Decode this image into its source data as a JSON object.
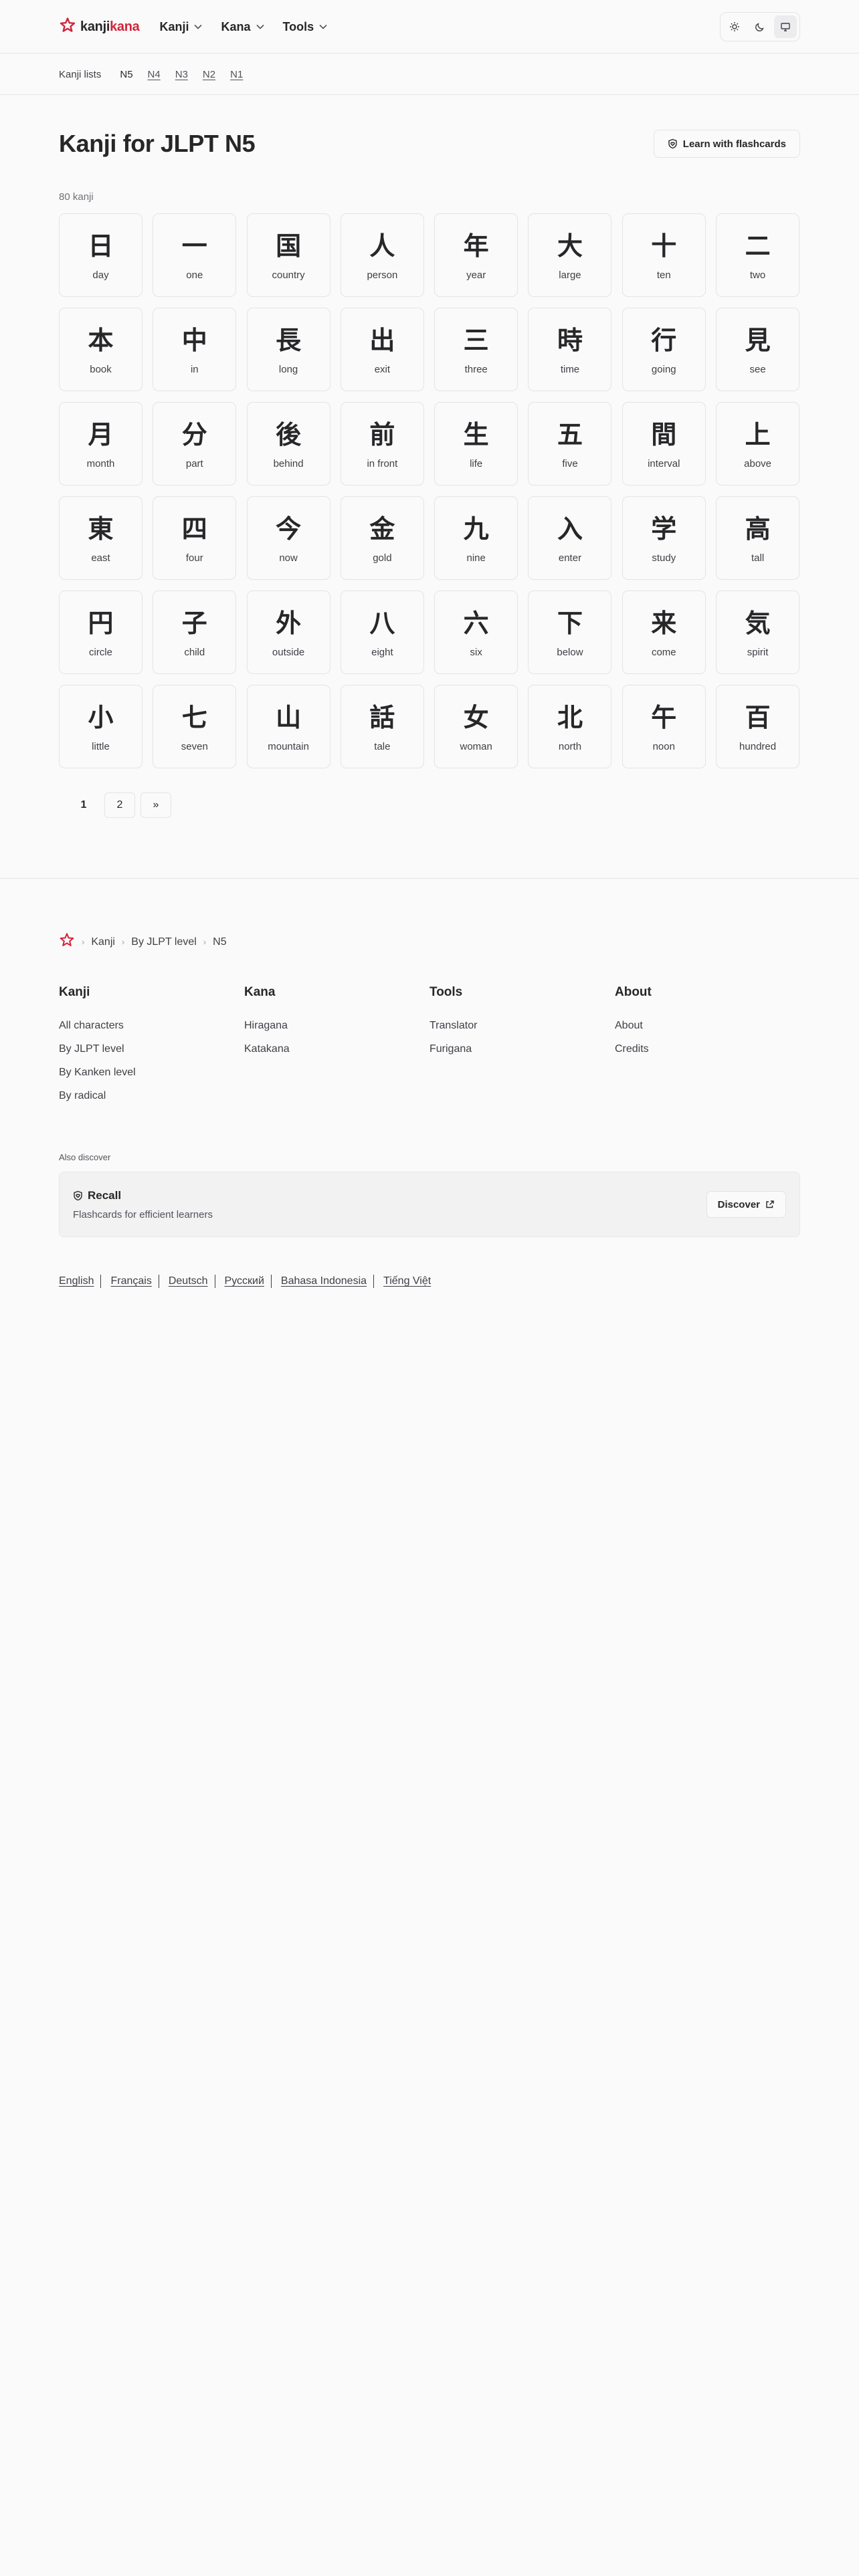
{
  "header": {
    "logo_part1": "kanji",
    "logo_part2": "kana",
    "nav": [
      {
        "label": "Kanji"
      },
      {
        "label": "Kana"
      },
      {
        "label": "Tools"
      }
    ],
    "theme_options": [
      "sun-icon",
      "moon-icon",
      "monitor-icon"
    ],
    "theme_active": "monitor-icon"
  },
  "subnav": {
    "label": "Kanji lists",
    "levels": [
      "N5",
      "N4",
      "N3",
      "N2",
      "N1"
    ],
    "current": "N5"
  },
  "main": {
    "title": "Kanji for JLPT N5",
    "flashcards_label": "Learn with flashcards",
    "count": "80 kanji"
  },
  "kanji": [
    {
      "char": "日",
      "meaning": "day"
    },
    {
      "char": "一",
      "meaning": "one"
    },
    {
      "char": "国",
      "meaning": "country"
    },
    {
      "char": "人",
      "meaning": "person"
    },
    {
      "char": "年",
      "meaning": "year"
    },
    {
      "char": "大",
      "meaning": "large"
    },
    {
      "char": "十",
      "meaning": "ten"
    },
    {
      "char": "二",
      "meaning": "two"
    },
    {
      "char": "本",
      "meaning": "book"
    },
    {
      "char": "中",
      "meaning": "in"
    },
    {
      "char": "長",
      "meaning": "long"
    },
    {
      "char": "出",
      "meaning": "exit"
    },
    {
      "char": "三",
      "meaning": "three"
    },
    {
      "char": "時",
      "meaning": "time"
    },
    {
      "char": "行",
      "meaning": "going"
    },
    {
      "char": "見",
      "meaning": "see"
    },
    {
      "char": "月",
      "meaning": "month"
    },
    {
      "char": "分",
      "meaning": "part"
    },
    {
      "char": "後",
      "meaning": "behind"
    },
    {
      "char": "前",
      "meaning": "in front"
    },
    {
      "char": "生",
      "meaning": "life"
    },
    {
      "char": "五",
      "meaning": "five"
    },
    {
      "char": "間",
      "meaning": "interval"
    },
    {
      "char": "上",
      "meaning": "above"
    },
    {
      "char": "東",
      "meaning": "east"
    },
    {
      "char": "四",
      "meaning": "four"
    },
    {
      "char": "今",
      "meaning": "now"
    },
    {
      "char": "金",
      "meaning": "gold"
    },
    {
      "char": "九",
      "meaning": "nine"
    },
    {
      "char": "入",
      "meaning": "enter"
    },
    {
      "char": "学",
      "meaning": "study"
    },
    {
      "char": "高",
      "meaning": "tall"
    },
    {
      "char": "円",
      "meaning": "circle"
    },
    {
      "char": "子",
      "meaning": "child"
    },
    {
      "char": "外",
      "meaning": "outside"
    },
    {
      "char": "八",
      "meaning": "eight"
    },
    {
      "char": "六",
      "meaning": "six"
    },
    {
      "char": "下",
      "meaning": "below"
    },
    {
      "char": "来",
      "meaning": "come"
    },
    {
      "char": "気",
      "meaning": "spirit"
    },
    {
      "char": "小",
      "meaning": "little"
    },
    {
      "char": "七",
      "meaning": "seven"
    },
    {
      "char": "山",
      "meaning": "mountain"
    },
    {
      "char": "話",
      "meaning": "tale"
    },
    {
      "char": "女",
      "meaning": "woman"
    },
    {
      "char": "北",
      "meaning": "north"
    },
    {
      "char": "午",
      "meaning": "noon"
    },
    {
      "char": "百",
      "meaning": "hundred"
    }
  ],
  "pagination": {
    "pages": [
      "1",
      "2"
    ],
    "current": "1",
    "next": "»"
  },
  "footer": {
    "breadcrumb": [
      "Kanji",
      "By JLPT level",
      "N5"
    ],
    "columns": [
      {
        "title": "Kanji",
        "links": [
          "All characters",
          "By JLPT level",
          "By Kanken level",
          "By radical"
        ]
      },
      {
        "title": "Kana",
        "links": [
          "Hiragana",
          "Katakana"
        ]
      },
      {
        "title": "Tools",
        "links": [
          "Translator",
          "Furigana"
        ]
      },
      {
        "title": "About",
        "links": [
          "About",
          "Credits"
        ]
      }
    ],
    "also_discover": "Also discover",
    "recall": {
      "name": "Recall",
      "description": "Flashcards for efficient learners",
      "button": "Discover"
    },
    "languages": [
      "English",
      "Français",
      "Deutsch",
      "Русский",
      "Bahasa Indonesia",
      "Tiếng Việt"
    ]
  },
  "colors": {
    "brand_red": "#d4233a",
    "text": "#27272a",
    "border": "#e4e4e7",
    "background": "#fafafa"
  }
}
